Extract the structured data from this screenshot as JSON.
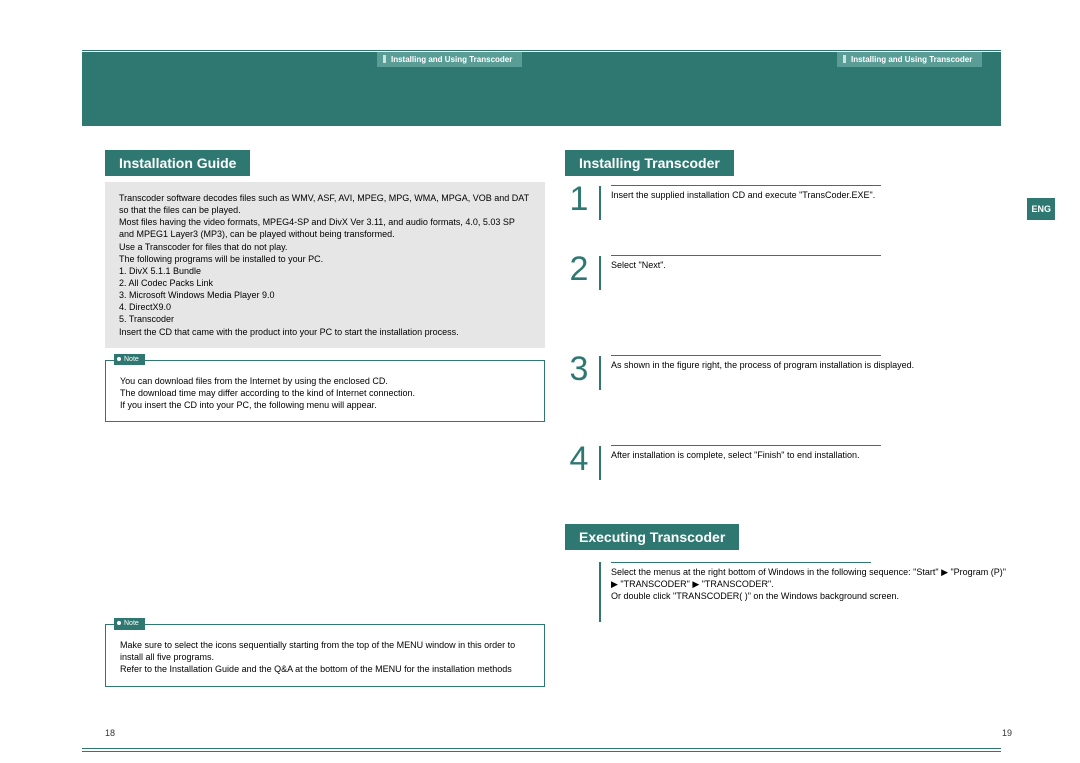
{
  "header": {
    "tab_left": "Installing and Using Transcoder",
    "tab_right": "Installing and Using Transcoder"
  },
  "left": {
    "section_title": "Installation Guide",
    "gray_text": "Transcoder software decodes files such as WMV, ASF, AVI, MPEG, MPG, WMA, MPGA, VOB and DAT so that the files can be played.\nMost files having the video formats, MPEG4-SP and DivX Ver 3.11, and audio formats, 4.0, 5.03 SP and MPEG1 Layer3 (MP3), can be played without being transformed.\nUse a Transcoder for files that do not play.\nThe following programs will be installed to your PC.\n1. DivX 5.1.1 Bundle\n2. All Codec Packs Link\n3. Microsoft Windows Media Player 9.0\n4. DirectX9.0\n5. Transcoder\nInsert the CD that came with the product into your PC to start the installation process.",
    "note1_label": "Note",
    "note1_text": "You can download files from the Internet by using the enclosed CD.\nThe download time may differ according to the kind of Internet connection.\nIf you insert the CD into your PC, the following menu will appear.",
    "note2_label": "Note",
    "note2_text": "Make sure to select the icons sequentially starting from the top of the MENU window in this order to install all five programs.\nRefer to the Installation Guide and the Q&A at the bottom of the MENU for the installation methods"
  },
  "right": {
    "section1_title": "Installing Transcoder",
    "steps": [
      {
        "num": "1",
        "text": "Insert the supplied installation CD and execute \"TransCoder.EXE\"."
      },
      {
        "num": "2",
        "text": "Select \"Next\"."
      },
      {
        "num": "3",
        "text": "As shown in the figure right, the process of program installation is displayed."
      },
      {
        "num": "4",
        "text": "After installation is complete, select \"Finish\" to end installation."
      }
    ],
    "section2_title": "Executing Transcoder",
    "exec_text": "Select the menus at the right bottom of Windows in the following sequence: \"Start\" ▶ \"Program (P)\" ▶ \"TRANSCODER\" ▶ \"TRANSCODER\".\nOr double click \"TRANSCODER(      )\" on the Windows background screen.",
    "eng": "ENG"
  },
  "pages": {
    "left": "18",
    "right": "19"
  }
}
